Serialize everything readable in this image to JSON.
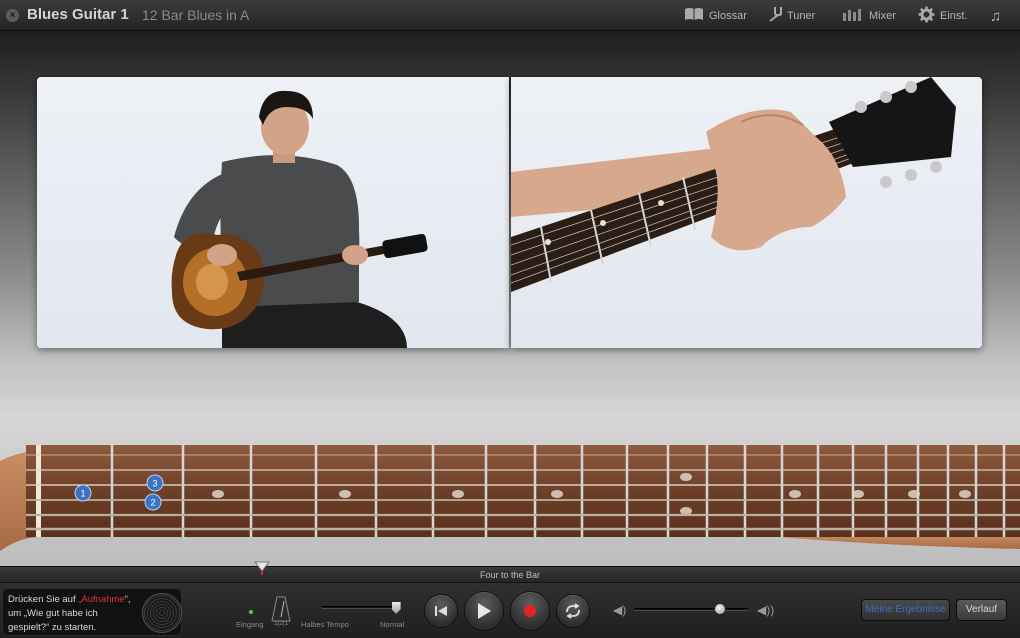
{
  "window": {
    "app_title": "Blues Guitar 1",
    "lesson_title": "12 Bar Blues in A"
  },
  "toolbar": {
    "glossar": "Glossar",
    "tuner": "Tuner",
    "mixer": "Mixer",
    "settings": "Einst."
  },
  "fretboard": {
    "finger_dots": [
      "1",
      "3",
      "2"
    ]
  },
  "transport": {
    "track_label": "Four to the Bar",
    "hint_line1": "Drücken Sie auf ",
    "hint_highlight": "„Aufnahme",
    "hint_line1_end": "“,",
    "hint_line2": "um „Wie gut habe ich",
    "hint_line3": "gespielt?“ zu starten.",
    "eingang_label": "Eingang",
    "metronome_label": "1|2|1",
    "half_tempo_label": "Halbes Tempo",
    "normal_label": "Normal",
    "tempo_level": 0.95,
    "volume_level": 0.75,
    "my_results_button": "Meine Ergebnisse",
    "history_button": "Verlauf"
  },
  "colors": {
    "record_red": "#e02525",
    "hint_red": "#e23030",
    "finger_dot_blue": "#3b73c4",
    "accent_blue": "#3c6fc0"
  }
}
